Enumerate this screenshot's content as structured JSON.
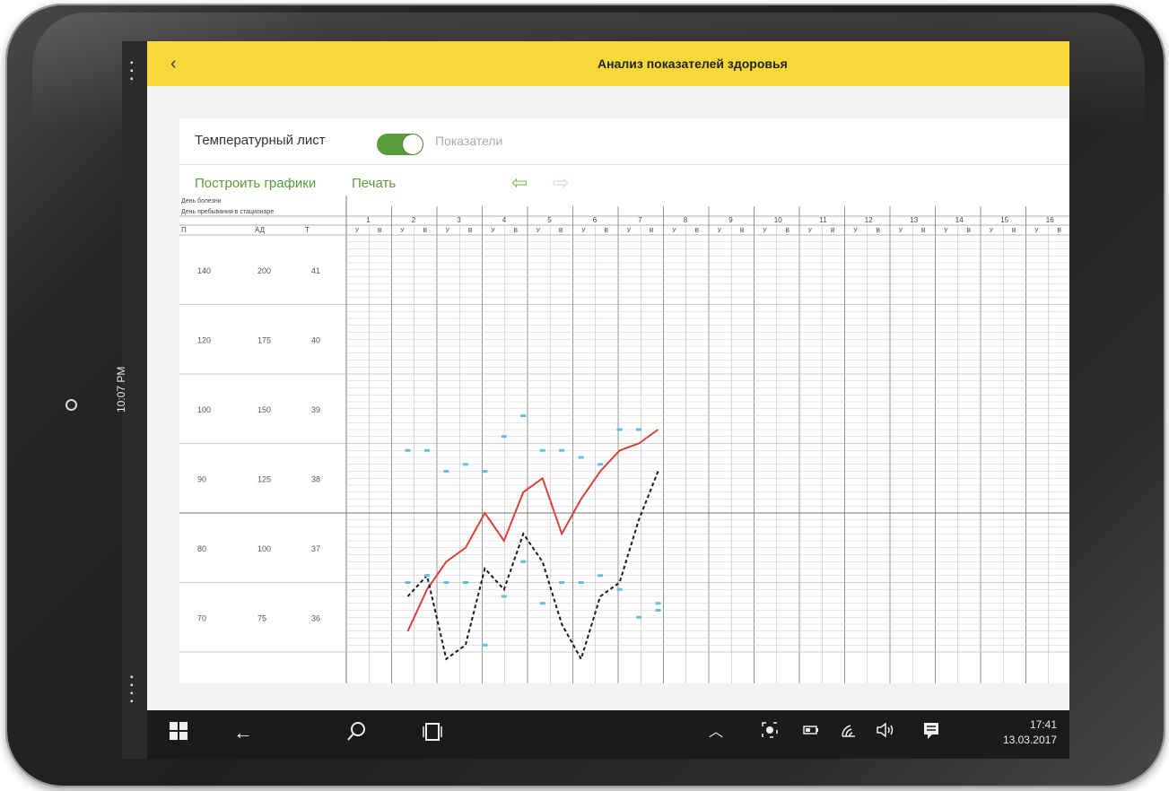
{
  "device": {
    "side_time": "10:07 PM"
  },
  "appbar": {
    "back_icon": "‹",
    "title": "Анализ показателей здоровья"
  },
  "toggle": {
    "left_label": "Температурный лист",
    "right_label": "Показатели",
    "on": true
  },
  "actions": {
    "build": "Построить графики",
    "print": "Печать",
    "prev_icon": "⇦",
    "next_icon": "⇨"
  },
  "chart_data": {
    "type": "line",
    "header_rows": [
      "День болезни",
      "День пребывания в стационаре"
    ],
    "axis_headers": [
      "П",
      "АД",
      "Т"
    ],
    "days": [
      "1",
      "2",
      "3",
      "4",
      "5",
      "6",
      "7",
      "8",
      "9",
      "10",
      "11",
      "12",
      "13",
      "14",
      "15",
      "16"
    ],
    "periods": [
      "У",
      "В"
    ],
    "scale_rows": [
      {
        "p": "140",
        "ad": "200",
        "t": "41"
      },
      {
        "p": "120",
        "ad": "175",
        "t": "40"
      },
      {
        "p": "100",
        "ad": "150",
        "t": "39"
      },
      {
        "p": "90",
        "ad": "125",
        "t": "38"
      },
      {
        "p": "80",
        "ad": "100",
        "t": "37"
      },
      {
        "p": "70",
        "ad": "75",
        "t": "36"
      }
    ],
    "series": [
      {
        "color": "#d9413b",
        "style": "solid",
        "t_values": [
          35.8,
          36.4,
          36.8,
          37.0,
          37.5,
          37.1,
          37.8,
          38.0,
          37.2,
          37.7,
          38.1,
          38.4,
          38.5,
          38.7
        ]
      },
      {
        "color": "#1a1a1a",
        "style": "dashed",
        "t_values": [
          36.3,
          36.6,
          35.4,
          35.6,
          36.7,
          36.4,
          37.2,
          36.8,
          35.9,
          35.4,
          36.3,
          36.5,
          37.4,
          38.1
        ]
      },
      {
        "color": "#5fc0e0",
        "style": "dotted",
        "t_values": [
          38.4,
          38.4,
          38.1,
          38.2,
          38.1,
          38.6,
          38.9,
          38.4,
          38.4,
          38.3,
          38.2,
          38.7,
          38.7,
          36.2
        ]
      },
      {
        "color": "#5fc0e0",
        "style": "dotted",
        "t_values": [
          36.5,
          36.6,
          36.5,
          36.5,
          35.6,
          36.3,
          36.8,
          36.2,
          36.5,
          36.5,
          36.6,
          36.4,
          36.0,
          36.1
        ]
      }
    ]
  },
  "taskbar": {
    "icons": [
      "windows-icon",
      "back-arrow-icon",
      "search-icon",
      "task-view-icon"
    ],
    "tray_icons": [
      "chevron-up-icon",
      "camera-icon",
      "battery-icon",
      "wifi-icon",
      "volume-icon",
      "action-center-icon"
    ],
    "time": "17:41",
    "date": "13.03.2017"
  }
}
